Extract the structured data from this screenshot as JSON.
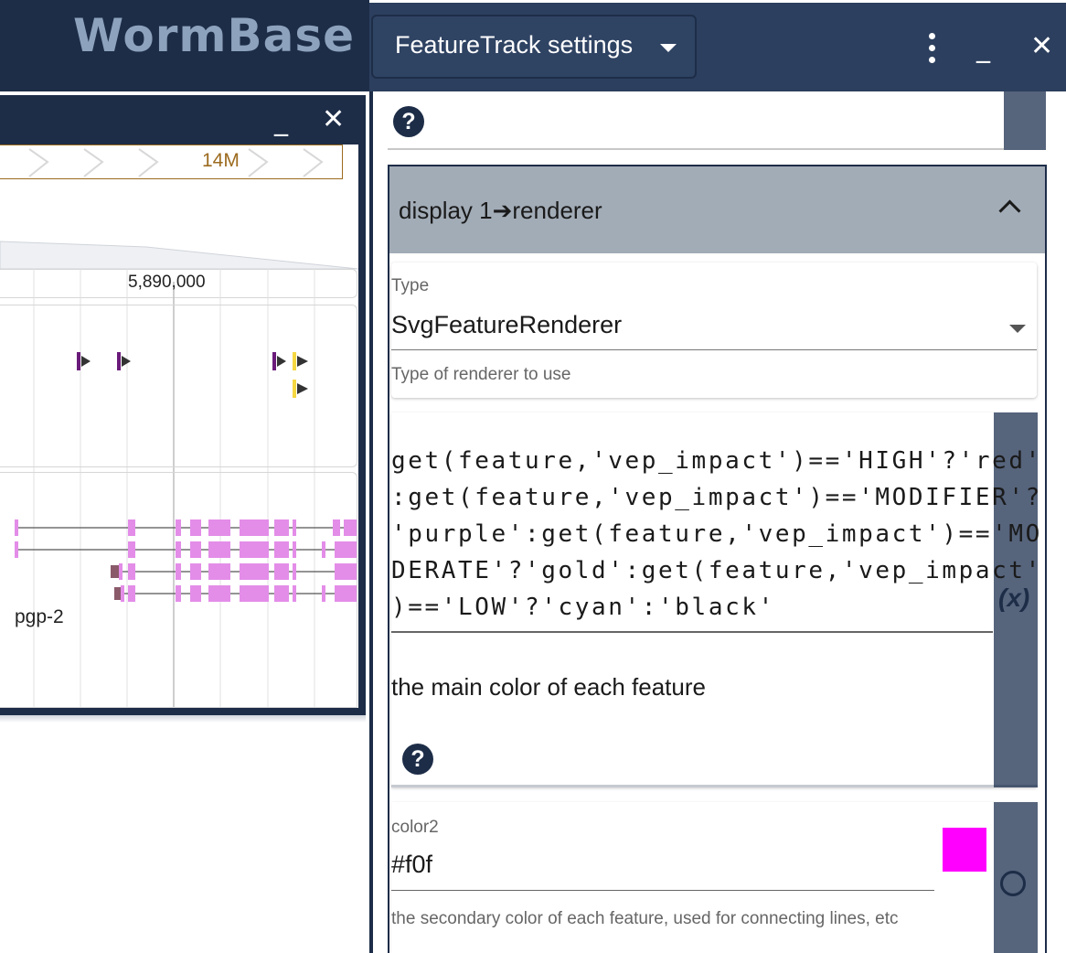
{
  "app": {
    "logo_text": "WormBase"
  },
  "view": {
    "minimize_icon": "minimize-icon",
    "close_icon": "close-icon",
    "overview_label": "14M",
    "ruler_label": "5,890,000",
    "gene_label": "pgp-2",
    "colors": {
      "header": "#1d2d48",
      "overview_border": "#9c6b1f",
      "exon": "#e38de8",
      "marker_purple": "#6a1b7a",
      "marker_yellow": "#f5d742"
    }
  },
  "drawer": {
    "title": "FeatureTrack settings",
    "menu_icon": "kebab-menu-icon",
    "minimize_label": "_",
    "close_label": "✕",
    "help_glyph": "?",
    "section": {
      "title": "display 1➔renderer"
    },
    "type_field": {
      "label": "Type",
      "value": "SvgFeatureRenderer",
      "help": "Type of renderer to use"
    },
    "color_field": {
      "code_lines": [
        "get(feature,'vep_impact')=='HIGH'?'red'",
        ":get(feature,'vep_impact')=='MODIFIER'?",
        "'purple':get(feature,'vep_impact')=='MO",
        "DERATE'?'gold':get(feature,'vep_impact'",
        ")=='LOW'?'cyan':'black'"
      ],
      "mode_label": "(x)",
      "description": "the main color of each feature"
    },
    "color2_field": {
      "label": "color2",
      "value": "#f0f",
      "swatch_color": "#ff00ff",
      "help": "the secondary color of each feature, used for connecting lines, etc"
    }
  }
}
